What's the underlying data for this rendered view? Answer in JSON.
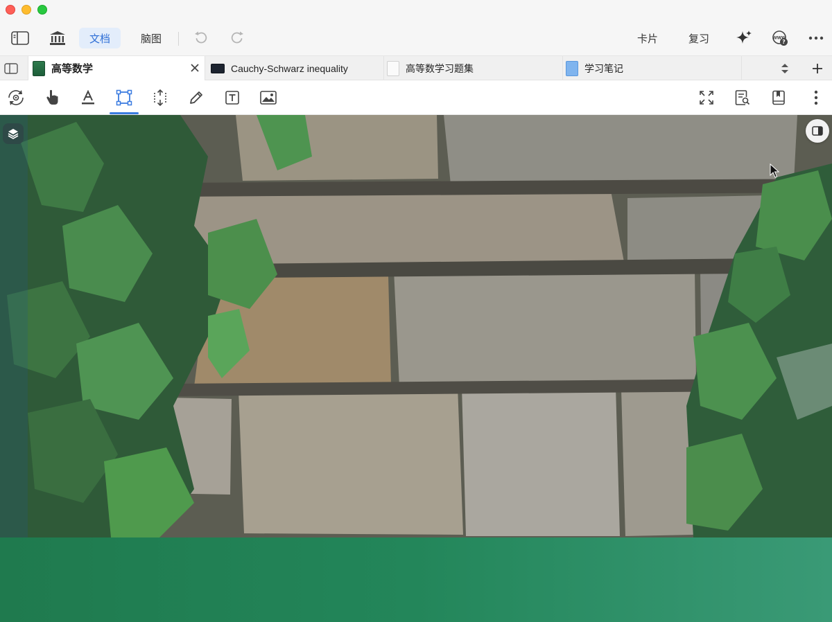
{
  "toolbar": {
    "doc_label": "文档",
    "mindmap_label": "脑图",
    "card_label": "卡片",
    "review_label": "复习"
  },
  "tabs": [
    {
      "label": "高等数学",
      "active": true
    },
    {
      "label": "Cauchy-Schwarz inequality",
      "active": false
    },
    {
      "label": "高等数学习题集",
      "active": false
    },
    {
      "label": "学习笔记",
      "active": false
    }
  ],
  "annotation_tools": {
    "active": "rectangle-select"
  },
  "colors": {
    "accent": "#3a7be0",
    "active_tab_bg": "#e3edfb",
    "banner_green": "#23865a"
  }
}
